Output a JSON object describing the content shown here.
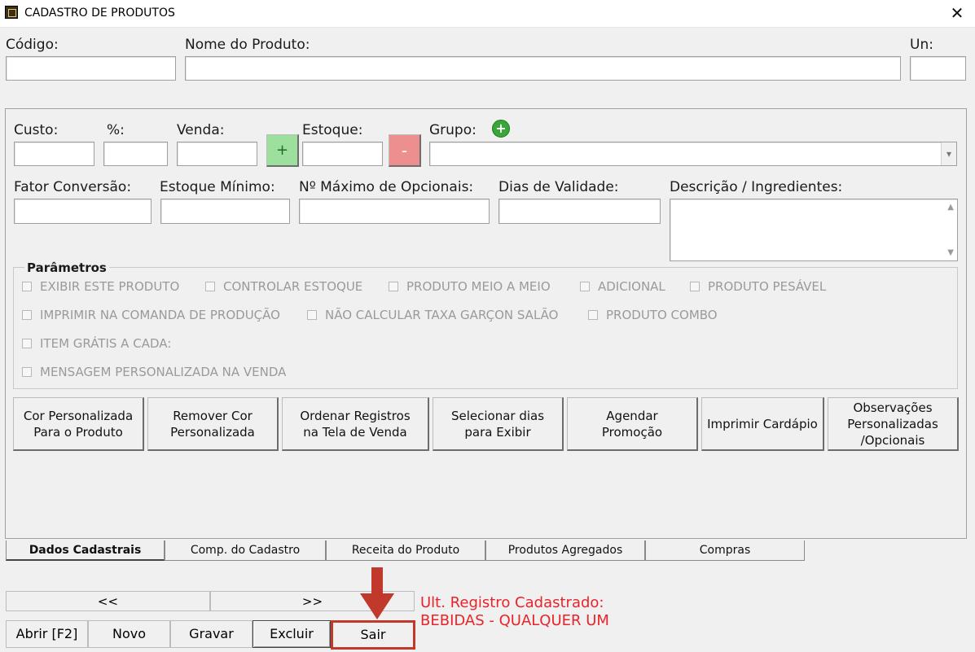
{
  "window": {
    "title": "CADASTRO DE PRODUTOS",
    "close_glyph": "✕"
  },
  "top_fields": {
    "codigo_label": "Código:",
    "nome_label": "Nome do Produto:",
    "un_label": "Un:",
    "codigo_value": "",
    "nome_value": "",
    "un_value": ""
  },
  "price_row": {
    "custo_label": "Custo:",
    "percent_label": "%:",
    "venda_label": "Venda:",
    "plus_glyph": "+",
    "estoque_label": "Estoque:",
    "minus_glyph": "-",
    "grupo_label": "Grupo:",
    "grupo_add_glyph": "+",
    "grupo_dropdown_glyph": "▾"
  },
  "second_row": {
    "fator_label": "Fator Conversão:",
    "estoque_min_label": "Estoque Mínimo:",
    "max_opcionais_label": "Nº Máximo de Opcionais:",
    "dias_validade_label": "Dias de Validade:",
    "descricao_label": "Descrição / Ingredientes:"
  },
  "parametros": {
    "title": "Parâmetros",
    "items": [
      "EXIBIR ESTE PRODUTO",
      "CONTROLAR ESTOQUE",
      "PRODUTO MEIO A MEIO",
      "ADICIONAL",
      "PRODUTO PESÁVEL",
      "IMPRIMIR NA COMANDA DE PRODUÇÃO",
      "NÃO CALCULAR TAXA GARÇON SALÃO",
      "PRODUTO COMBO",
      "ITEM GRÁTIS A CADA:",
      "MENSAGEM PERSONALIZADA NA VENDA"
    ]
  },
  "action_buttons": [
    {
      "line1": "Cor Personalizada",
      "line2": "Para o Produto"
    },
    {
      "line1": "Remover Cor",
      "line2": "Personalizada"
    },
    {
      "line1": "Ordenar Registros",
      "line2": "na Tela de Venda"
    },
    {
      "line1": "Selecionar dias",
      "line2": "para  Exibir"
    },
    {
      "line1": "Agendar",
      "line2": "Promoção"
    },
    {
      "line1": "Imprimir Cardápio",
      "line2": ""
    },
    {
      "line1": "Observações",
      "line2": "Personalizadas",
      "line3": "/Opcionais"
    }
  ],
  "tabs": [
    "Dados Cadastrais",
    "Comp. do Cadastro",
    "Receita do Produto",
    "Produtos Agregados",
    "Compras"
  ],
  "nav": {
    "prev": "<<",
    "next": ">>"
  },
  "bottom_buttons": {
    "abrir": "Abrir [F2]",
    "novo": "Novo",
    "gravar": "Gravar",
    "excluir": "Excluir",
    "sair": "Sair"
  },
  "status": {
    "line1": "Ult. Registro Cadastrado:",
    "line2": "BEBIDAS - QUALQUER UM"
  },
  "colors": {
    "highlight_red": "#c0392b",
    "status_red": "#e8242a"
  }
}
